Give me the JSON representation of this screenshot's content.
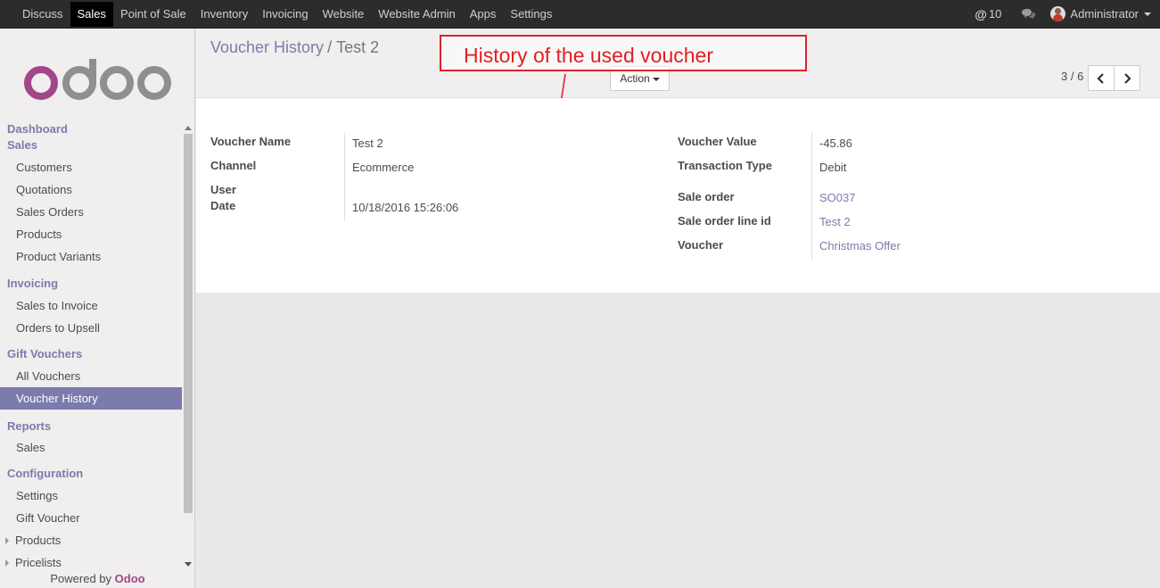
{
  "topbar": {
    "menu": [
      "Discuss",
      "Sales",
      "Point of Sale",
      "Inventory",
      "Invoicing",
      "Website",
      "Website Admin",
      "Apps",
      "Settings"
    ],
    "active_menu": "Sales",
    "mentions_count": "10",
    "user": "Administrator"
  },
  "sidebar": {
    "logo_text": "odoo",
    "dashboard": "Dashboard",
    "sales_head": "Sales",
    "sales_items": [
      "Customers",
      "Quotations",
      "Sales Orders",
      "Products",
      "Product Variants"
    ],
    "invoicing_head": "Invoicing",
    "invoicing_items": [
      "Sales to Invoice",
      "Orders to Upsell"
    ],
    "gift_head": "Gift Vouchers",
    "gift_items": [
      "All Vouchers",
      "Voucher History"
    ],
    "reports_head": "Reports",
    "reports_items": [
      "Sales"
    ],
    "config_head": "Configuration",
    "config_items": [
      "Settings",
      "Gift Voucher",
      "Products",
      "Pricelists"
    ],
    "powered_prefix": "Powered by",
    "powered_brand": "Odoo"
  },
  "control_panel": {
    "breadcrumb_parent": "Voucher History",
    "breadcrumb_sep": "/",
    "breadcrumb_current": "Test 2",
    "action_label": "Action",
    "pager": "3 / 6"
  },
  "annotation": {
    "text": "History of the used voucher",
    "color": "#e21d25"
  },
  "form": {
    "left": {
      "voucher_name_label": "Voucher Name",
      "voucher_name": "Test 2",
      "channel_label": "Channel",
      "channel": "Ecommerce",
      "user_label": "User",
      "date_label": "Date",
      "date": "10/18/2016 15:26:06"
    },
    "right": {
      "voucher_value_label": "Voucher Value",
      "voucher_value": "-45.86",
      "transaction_type_label": "Transaction Type",
      "transaction_type": "Debit",
      "sale_order_label": "Sale order",
      "sale_order": "SO037",
      "sale_order_line_label": "Sale order line id",
      "sale_order_line": "Test 2",
      "voucher_label": "Voucher",
      "voucher": "Christmas Offer"
    }
  },
  "colors": {
    "topbar": "#2c2c2c",
    "accent": "#7c7bad",
    "brand": "#a24689"
  }
}
